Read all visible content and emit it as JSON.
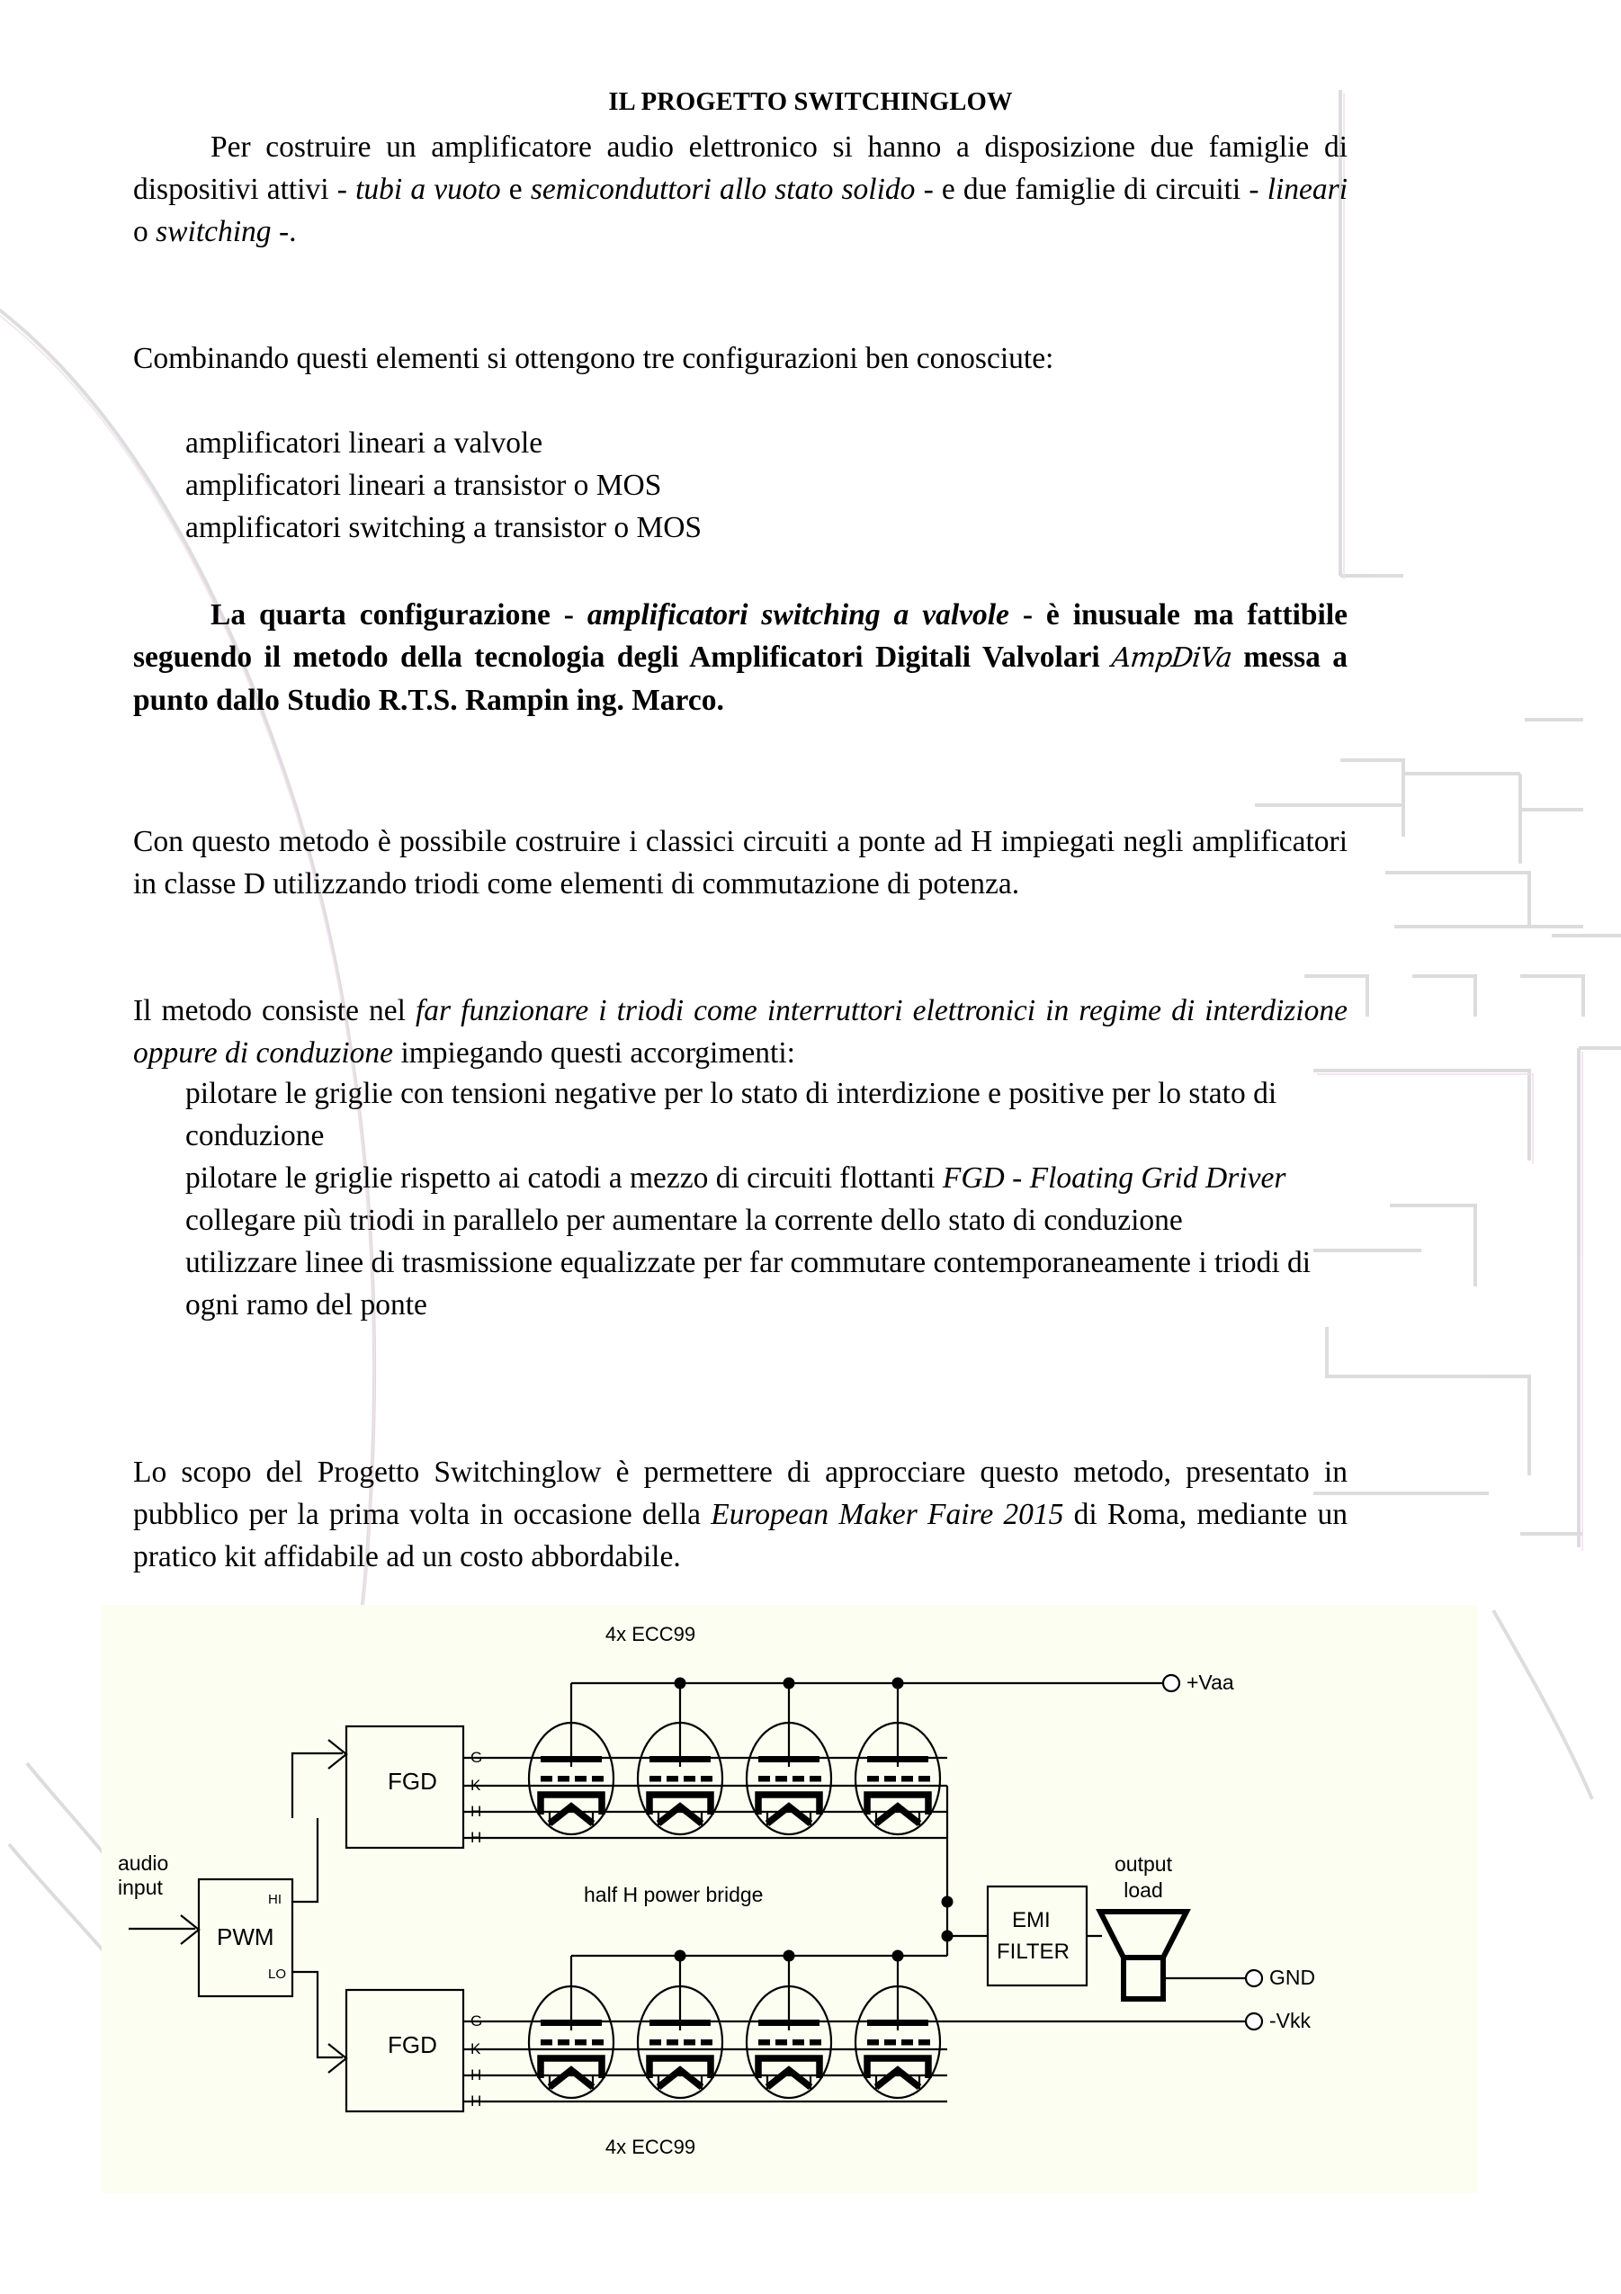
{
  "document": {
    "title": "IL PROGETTO SWITCHINGLOW",
    "paragraphs": {
      "p1_a": "Per costruire un amplificatore audio elettronico si hanno a disposizione due famiglie di dispositivi attivi - ",
      "p1_i1": "tubi a vuoto",
      "p1_b": " e ",
      "p1_i2": "semiconduttori allo stato solido",
      "p1_c": " - e due famiglie di circuiti - ",
      "p1_i3": "lineari",
      "p1_d": " o ",
      "p1_i4": "switching",
      "p1_e": " -.",
      "p2": "Combinando questi elementi si ottengono tre configurazioni ben conosciute:",
      "list1": [
        "amplificatori lineari a valvole",
        "amplificatori lineari a transistor o MOS",
        "amplificatori switching a transistor o MOS"
      ],
      "p3_a": "La quarta configurazione - ",
      "p3_i1": "amplificatori switching a valvole",
      "p3_b": " - è inusuale ma fattibile seguendo il metodo della tecnologia degli Amplificatori Digitali Valvolari ",
      "p3_logo": "AmpDiVa",
      "p3_c": " messa a punto dallo Studio R.T.S. Rampin ing. Marco.",
      "p4": "Con questo metodo è possibile costruire i classici circuiti a ponte ad H impiegati negli amplificatori in classe D utilizzando triodi come elementi di commutazione di potenza.",
      "p5_a": "Il metodo consiste nel ",
      "p5_i1": "far funzionare i triodi come interruttori elettronici in regime di interdizione oppure di conduzione",
      "p5_b": " impiegando questi accorgimenti:",
      "list2": [
        {
          "line1": "pilotare le griglie con tensioni negative per lo stato di interdizione e",
          "line2": "positive per lo stato di conduzione",
          "italic_tail": ""
        },
        {
          "line1": "pilotare le griglie rispetto ai catodi a mezzo di circuiti flottanti ",
          "line1_italic": "FGD -",
          "line2_italic": "Floating Grid Driver"
        },
        {
          "line1": "collegare più triodi in parallelo per aumentare la corrente dello stato di",
          "line2": "conduzione"
        },
        {
          "line1": "utilizzare linee di trasmissione equalizzate per far commutare",
          "line2": "contemporaneamente i triodi di ogni ramo del ponte"
        }
      ],
      "p6_a": "Lo scopo del Progetto Switchinglow è permettere di approcciare questo metodo, presentato in pubblico per la prima volta in occasione della ",
      "p6_i1": "European Maker Faire 2015",
      "p6_b": " di Roma, mediante un pratico kit affidabile ad un costo abbordabile."
    }
  },
  "diagram": {
    "background_color": "#fdfef2",
    "labels": {
      "top_tubes": "4x ECC99",
      "bottom_tubes": "4x ECC99",
      "bridge": "half H power bridge",
      "audio_input_line1": "audio",
      "audio_input_line2": "input",
      "pwm": "PWM",
      "pwm_hi": "HI",
      "pwm_lo": "LO",
      "fgd_top": "FGD",
      "fgd_bottom": "FGD",
      "fgd_pins": [
        "G",
        "K",
        "H",
        "H"
      ],
      "emi_line1": "EMI",
      "emi_line2": "FILTER",
      "output_line1": "output",
      "output_line2": "load",
      "terminal_vaa": "+Vaa",
      "terminal_gnd": "GND",
      "terminal_vkk": "-Vkk"
    }
  }
}
